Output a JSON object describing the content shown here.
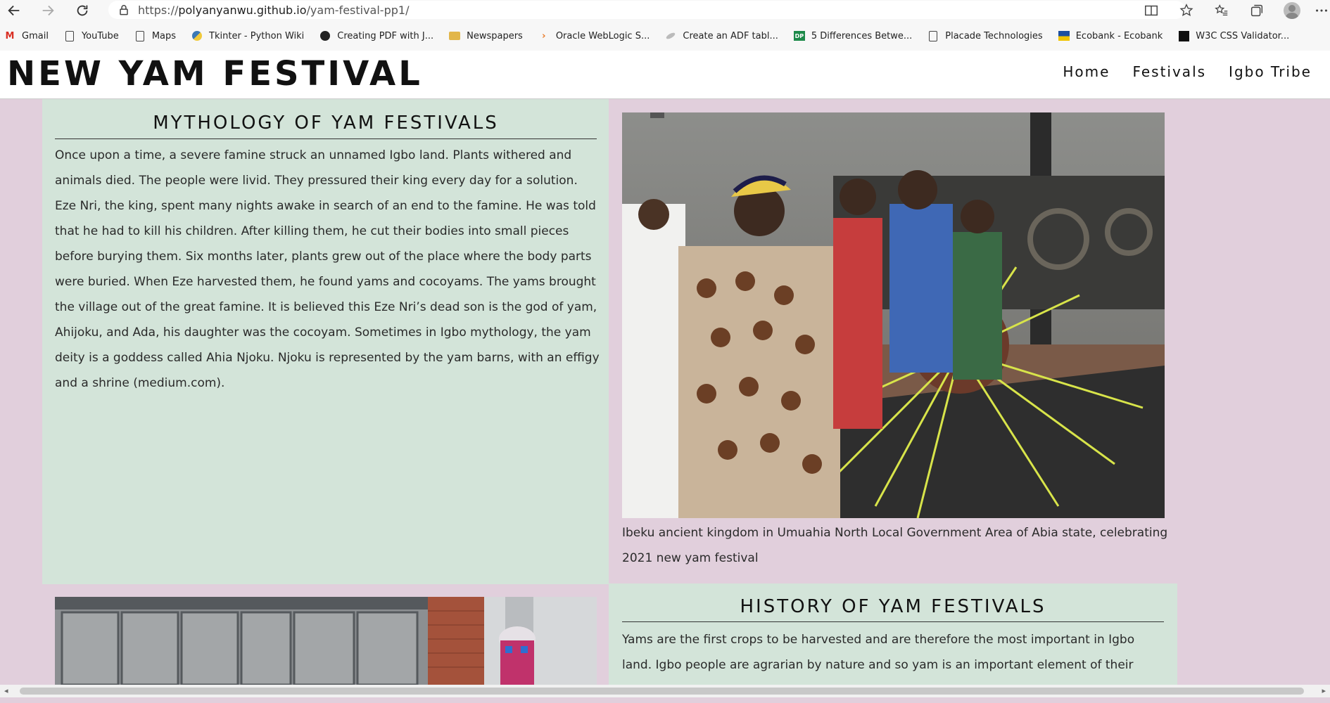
{
  "browser": {
    "url_prefix": "https://",
    "url_host": "polyanyanwu.github.io",
    "url_path": "/yam-festival-pp1/",
    "bookmarks": [
      {
        "label": "Gmail",
        "icon": "gmail-icon"
      },
      {
        "label": "YouTube",
        "icon": "page-icon"
      },
      {
        "label": "Maps",
        "icon": "page-icon"
      },
      {
        "label": "Tkinter - Python Wiki",
        "icon": "python-icon"
      },
      {
        "label": "Creating PDF with J...",
        "icon": "github-icon"
      },
      {
        "label": "Newspapers",
        "icon": "folder-icon"
      },
      {
        "label": "Oracle WebLogic S...",
        "icon": "oracle-icon"
      },
      {
        "label": "Create an ADF tabl...",
        "icon": "feather-icon"
      },
      {
        "label": "5 Differences Betwe...",
        "icon": "dp-icon"
      },
      {
        "label": "Placade Technologies",
        "icon": "page-icon"
      },
      {
        "label": "Ecobank - Ecobank",
        "icon": "ecobank-icon"
      },
      {
        "label": "W3C CSS Validator...",
        "icon": "w3c-icon"
      }
    ]
  },
  "site": {
    "logo": "NEW YAM FESTIVAL",
    "nav": [
      "Home",
      "Festivals",
      "Igbo Tribe"
    ]
  },
  "mythology": {
    "title": "MYTHOLOGY OF YAM FESTIVALS",
    "text": "Once upon a time, a severe famine struck an unnamed Igbo land. Plants withered and animals died. The people were livid. They pressured their king every day for a solution. Eze Nri, the king, spent many nights awake in search of an end to the famine. He was told that he had to kill his children. After killing them, he cut their bodies into small pieces before burying them. Six months later, plants grew out of the place where the body parts were buried. When Eze harvested them, he found yams and cocoyams. The yams brought the village out of the great famine. It is believed this Eze Nri’s dead son is the god of yam, Ahijoku, and Ada, his daughter was the cocoyam. Sometimes in Igbo mythology, the yam deity is a goddess called Ahia Njoku. Njoku is represented by the yam barns, with an effigy and a shrine (medium.com)."
  },
  "photo_caption": "Ibeku ancient kingdom in Umuahia North Local Government Area of Abia state, celebrating 2021 new yam festival",
  "history": {
    "title": "HISTORY OF YAM FESTIVALS",
    "text": "Yams are the first crops to be harvested and are therefore the most important in Igbo land. Igbo people are agrarian by nature and so yam is an important element of their culture. The"
  }
}
